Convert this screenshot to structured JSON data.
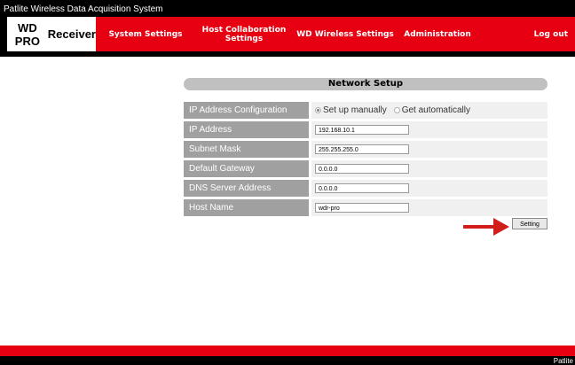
{
  "app": {
    "title": "Patlite Wireless Data Acquisition System"
  },
  "brand": {
    "line1": "WD PRO",
    "line2": "Receiver"
  },
  "nav": {
    "items": [
      {
        "label": "System Settings"
      },
      {
        "label": "Host Collaboration Settings"
      },
      {
        "label": "WD Wireless Settings"
      },
      {
        "label": "Administration"
      }
    ],
    "logout": "Log out"
  },
  "panel": {
    "title": "Network Setup"
  },
  "form": {
    "ip_config": {
      "label": "IP Address Configuration",
      "options": [
        "Set up manually",
        "Get automatically"
      ],
      "selected": "Set up manually"
    },
    "ip_address": {
      "label": "IP Address",
      "value": "192.168.10.1"
    },
    "subnet_mask": {
      "label": "Subnet Mask",
      "value": "255.255.255.0"
    },
    "default_gateway": {
      "label": "Default Gateway",
      "value": "0.0.0.0"
    },
    "dns_server": {
      "label": "DNS Server Address",
      "value": "0.0.0.0"
    },
    "host_name": {
      "label": "Host Name",
      "value": "wdr-pro"
    }
  },
  "setting_button": {
    "label": "Setting"
  },
  "footer": {
    "text": "Patlite"
  },
  "colors": {
    "brand_red": "#e60012",
    "label_gray": "#a0a0a0",
    "arrow_red": "#d21d1d"
  }
}
